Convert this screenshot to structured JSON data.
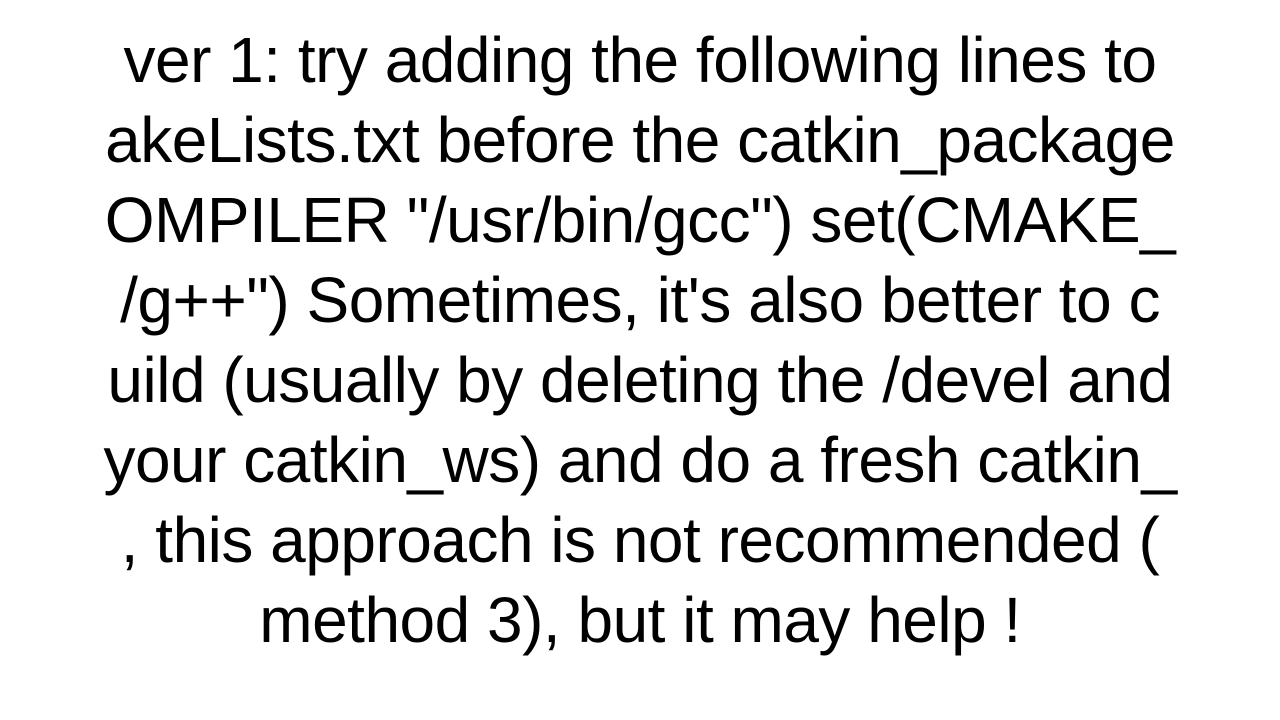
{
  "answer": {
    "line1": "ver 1: try adding the following lines to",
    "line2": "akeLists.txt before the catkin_package",
    "line3": "OMPILER \"/usr/bin/gcc\") set(CMAKE_",
    "line4": "/g++\")  Sometimes, it's also better to c",
    "line5": "uild (usually by deleting the /devel and",
    "line6": "your catkin_ws) and do a fresh catkin_",
    "line7": ", this approach is not recommended (",
    "line8": "method 3), but it may help !"
  }
}
